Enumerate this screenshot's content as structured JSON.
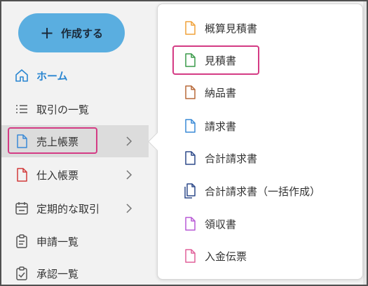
{
  "create_button": {
    "label": "作成する"
  },
  "nav": {
    "home": "ホーム",
    "transactions": "取引の一覧",
    "sales_docs": "売上帳票",
    "purchase_docs": "仕入帳票",
    "recurring": "定期的な取引",
    "applications": "申請一覧",
    "approvals": "承認一覧"
  },
  "submenu": {
    "items": [
      {
        "label": "概算見積書",
        "color": "#f0a23a"
      },
      {
        "label": "見積書",
        "color": "#3a9a4a"
      },
      {
        "label": "納品書",
        "color": "#b86a3a"
      },
      {
        "label": "請求書",
        "color": "#3a8ad6"
      },
      {
        "label": "合計請求書",
        "color": "#2e4a8a"
      },
      {
        "label": "合計請求書（一括作成）",
        "color": "#2e4a8a"
      },
      {
        "label": "領収書",
        "color": "#b85ad6"
      },
      {
        "label": "入金伝票",
        "color": "#e0609a"
      }
    ]
  },
  "colors": {
    "accent": "#5aaee0",
    "highlight": "#d43b84",
    "home": "#2a86d1"
  }
}
